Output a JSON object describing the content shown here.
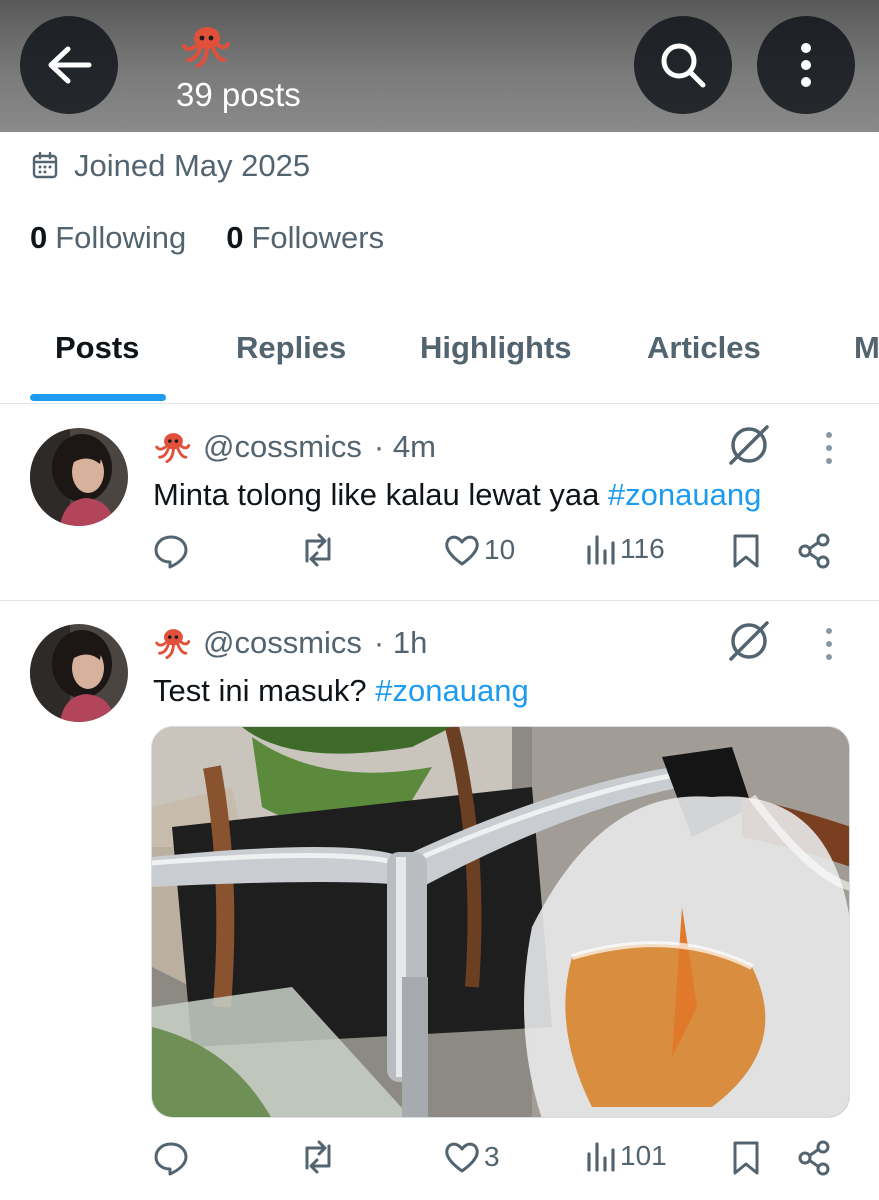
{
  "header": {
    "post_count": "39 posts",
    "profile_emoji": "octopus-emoji"
  },
  "profile": {
    "joined": "Joined May 2025",
    "following_count": "0",
    "following_label": "Following",
    "followers_count": "0",
    "followers_label": "Followers"
  },
  "tabs": [
    {
      "label": "Posts",
      "active": true
    },
    {
      "label": "Replies",
      "active": false
    },
    {
      "label": "Highlights",
      "active": false
    },
    {
      "label": "Articles",
      "active": false
    },
    {
      "label": "M",
      "active": false
    }
  ],
  "posts": [
    {
      "handle": "@cossmics",
      "time": "· 4m",
      "text": "Minta tolong like kalau lewat yaa ",
      "hashtag": "#zonauang",
      "likes": "10",
      "views": "116",
      "has_media": false
    },
    {
      "handle": "@cossmics",
      "time": "· 1h",
      "text": "Test ini masuk? ",
      "hashtag": "#zonauang",
      "likes": "3",
      "views": "101",
      "has_media": true
    }
  ],
  "colors": {
    "accent": "#1d9bf0",
    "secondary_text": "#536471",
    "primary_text": "#0f1419",
    "octopus": "#e0503a"
  }
}
